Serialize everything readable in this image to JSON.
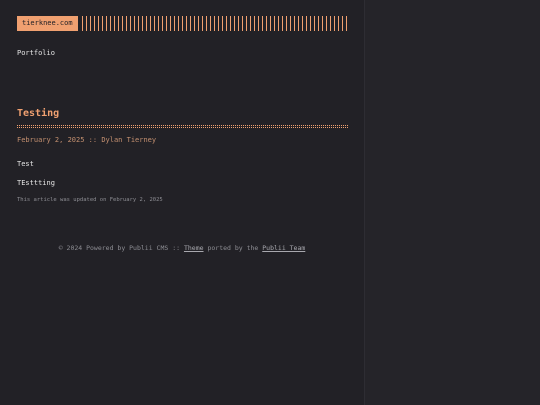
{
  "header": {
    "logo_text": "tierknee.com"
  },
  "nav": {
    "items": [
      {
        "label": "Portfolio"
      }
    ]
  },
  "post": {
    "title": "Testing",
    "date": "February 2, 2025",
    "separator": "::",
    "author": "Dylan Tierney",
    "body": [
      "Test",
      "TEsttting"
    ],
    "updated_note": "This article was updated on February 2, 2025"
  },
  "footer": {
    "prefix": "© 2024 Powered by Publii CMS ::",
    "theme_link": "Theme",
    "middle": "ported by the",
    "team_link": "Publii Team"
  },
  "colors": {
    "accent": "#f0a070",
    "background": "#222126",
    "text": "#e6e6e6",
    "muted": "#8e8e94"
  }
}
